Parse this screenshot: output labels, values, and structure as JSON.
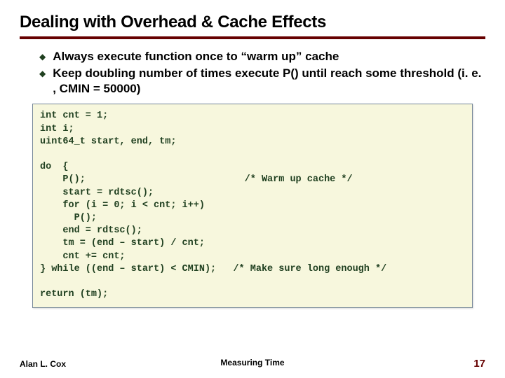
{
  "title": "Dealing with Overhead & Cache Effects",
  "bullets": [
    "Always execute function once to “warm up” cache",
    "Keep doubling number of times execute P() until reach some threshold (i. e. , CMIN = 50000)"
  ],
  "code": "int cnt = 1;\nint i;\nuint64_t start, end, tm;\n\ndo  {\n    P();                            /* Warm up cache */\n    start = rdtsc();\n    for (i = 0; i < cnt; i++)\n      P();\n    end = rdtsc();\n    tm = (end – start) / cnt;\n    cnt += cnt;\n} while ((end – start) < CMIN);   /* Make sure long enough */\n\nreturn (tm);",
  "footer": {
    "author": "Alan L. Cox",
    "topic": "Measuring Time",
    "page": "17"
  }
}
